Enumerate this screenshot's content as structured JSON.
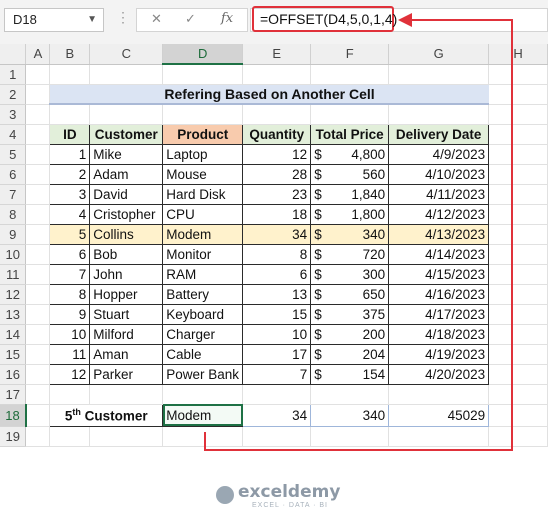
{
  "formula_bar": {
    "name_box": "D18",
    "cancel_icon": "✕",
    "enter_icon": "✓",
    "fx_label": "fx",
    "formula": "=OFFSET(D4,5,0,1,4)"
  },
  "columns": [
    "A",
    "B",
    "C",
    "D",
    "E",
    "F",
    "G",
    "H"
  ],
  "rows": [
    "1",
    "2",
    "3",
    "4",
    "5",
    "6",
    "7",
    "8",
    "9",
    "10",
    "11",
    "12",
    "13",
    "14",
    "15",
    "16",
    "17",
    "18",
    "19"
  ],
  "title": "Refering Based on Another Cell",
  "table": {
    "headers": [
      "ID",
      "Customer",
      "Product",
      "Quantity",
      "Total Price",
      "Delivery Date"
    ],
    "currency": "$",
    "highlight_row_index": 4,
    "rows": [
      {
        "id": "1",
        "customer": "Mike",
        "product": "Laptop",
        "quantity": "12",
        "price": "4,800",
        "date": "4/9/2023"
      },
      {
        "id": "2",
        "customer": "Adam",
        "product": "Mouse",
        "quantity": "28",
        "price": "560",
        "date": "4/10/2023"
      },
      {
        "id": "3",
        "customer": "David",
        "product": "Hard Disk",
        "quantity": "23",
        "price": "1,840",
        "date": "4/11/2023"
      },
      {
        "id": "4",
        "customer": "Cristopher",
        "product": "CPU",
        "quantity": "18",
        "price": "1,800",
        "date": "4/12/2023"
      },
      {
        "id": "5",
        "customer": "Collins",
        "product": "Modem",
        "quantity": "34",
        "price": "340",
        "date": "4/13/2023"
      },
      {
        "id": "6",
        "customer": "Bob",
        "product": "Monitor",
        "quantity": "8",
        "price": "720",
        "date": "4/14/2023"
      },
      {
        "id": "7",
        "customer": "John",
        "product": "RAM",
        "quantity": "6",
        "price": "300",
        "date": "4/15/2023"
      },
      {
        "id": "8",
        "customer": "Hopper",
        "product": "Battery",
        "quantity": "13",
        "price": "650",
        "date": "4/16/2023"
      },
      {
        "id": "9",
        "customer": "Stuart",
        "product": "Keyboard",
        "quantity": "15",
        "price": "375",
        "date": "4/17/2023"
      },
      {
        "id": "10",
        "customer": "Milford",
        "product": "Charger",
        "quantity": "10",
        "price": "200",
        "date": "4/18/2023"
      },
      {
        "id": "11",
        "customer": "Aman",
        "product": "Cable",
        "quantity": "17",
        "price": "204",
        "date": "4/19/2023"
      },
      {
        "id": "12",
        "customer": "Parker",
        "product": "Power Bank",
        "quantity": "7",
        "price": "154",
        "date": "4/20/2023"
      }
    ]
  },
  "result": {
    "label_num": "5",
    "label_sup": "th",
    "label_text": " Customer",
    "product": "Modem",
    "quantity": "34",
    "price": "340",
    "date": "45029"
  },
  "watermark": {
    "name": "exceldemy",
    "tagline": "EXCEL · DATA · BI"
  },
  "colors": {
    "accent_red": "#e0313a",
    "excel_green": "#1e7145",
    "title_bg": "#dbe4f3",
    "header_bg": "#e2efda",
    "product_header_bg": "#f8cbad",
    "highlight_row_bg": "#fff2cc"
  }
}
